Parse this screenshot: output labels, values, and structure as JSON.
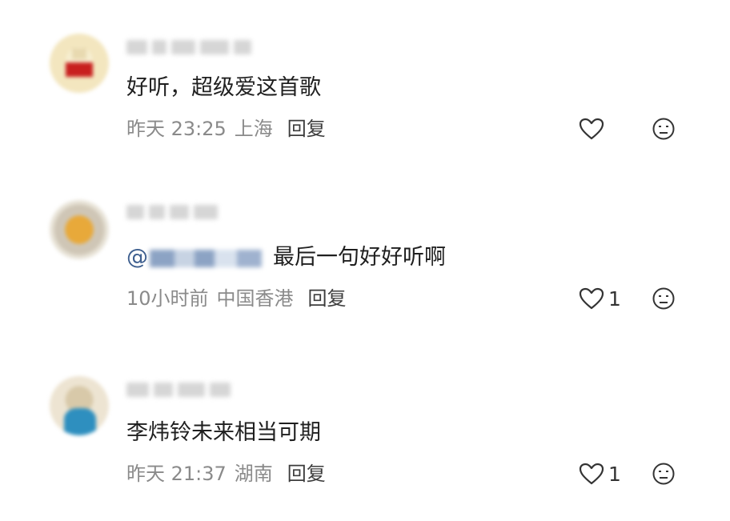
{
  "comments": [
    {
      "text": "好听，超级爱这首歌",
      "mention": "",
      "time": "昨天 23:25",
      "location": "上海",
      "reply_label": "回复",
      "like_count": "",
      "avatar_colors": [
        "#f3e6bf",
        "#c81f1f",
        "#f7efd2"
      ]
    },
    {
      "text": "最后一句好好听啊",
      "mention": "@",
      "time": "10小时前",
      "location": "中国香港",
      "reply_label": "回复",
      "like_count": "1",
      "avatar_colors": [
        "#e7e2d6",
        "#e8a93a",
        "#cfc6b6"
      ]
    },
    {
      "text": "李炜铃未来相当可期",
      "mention": "",
      "time": "昨天 21:37",
      "location": "湖南",
      "reply_label": "回复",
      "like_count": "1",
      "avatar_colors": [
        "#ede4d2",
        "#2e8fbf",
        "#d8c9a9"
      ]
    }
  ],
  "icons": {
    "like": "heart-outline-icon",
    "dislike": "frown-face-icon"
  },
  "colors": {
    "text": "#1f1f1f",
    "meta": "#8a8a8a",
    "mention": "#3e5f8f",
    "icon": "#333333"
  }
}
